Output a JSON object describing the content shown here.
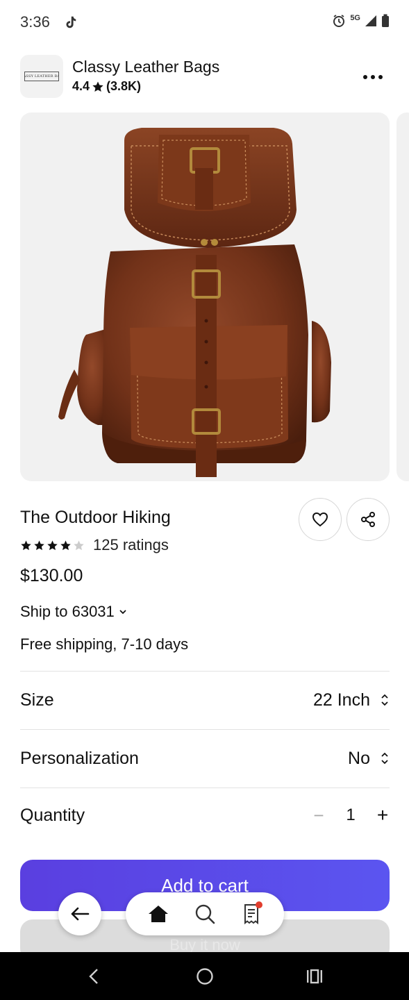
{
  "status_bar": {
    "time": "3:36",
    "network": "5G",
    "icons": [
      "tiktok-icon",
      "alarm-icon",
      "signal-icon",
      "battery-icon"
    ]
  },
  "shop": {
    "name": "Classy Leather Bags",
    "rating": "4.4",
    "review_count": "(3.8K)",
    "logo_text": "CLASSY LEATHER BAGS"
  },
  "product": {
    "title": "The Outdoor Hiking",
    "stars": 4,
    "max_stars": 5,
    "ratings": "125 ratings",
    "price": "$130.00",
    "ship_to": "Ship to 63031",
    "shipping": "Free shipping, 7-10 days"
  },
  "options": {
    "size_label": "Size",
    "size_value": "22 Inch",
    "personalization_label": "Personalization",
    "personalization_value": "No",
    "quantity_label": "Quantity",
    "quantity_minus": "−",
    "quantity_value": "1",
    "quantity_plus": "+"
  },
  "actions": {
    "add_to_cart": "Add to cart",
    "secondary": "Buy it now"
  },
  "colors": {
    "accent": "#5a3fe0",
    "leather": "#7a3a1e",
    "notification": "#e13d2d"
  }
}
